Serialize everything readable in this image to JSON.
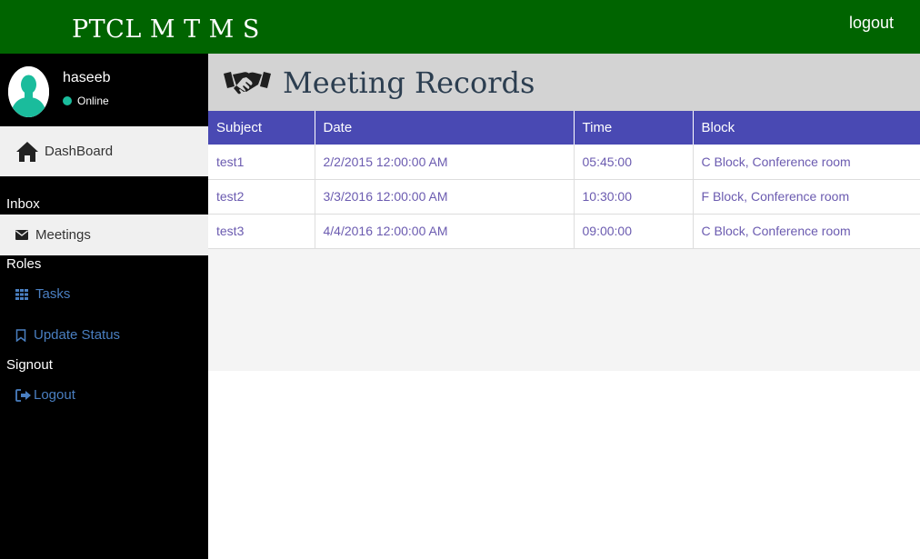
{
  "header": {
    "brand": "PTCL M T M S",
    "logout_label": "logout"
  },
  "user": {
    "name": "haseeb",
    "status": "Online"
  },
  "sidebar": {
    "dashboard_label": "DashBoard",
    "sections": [
      {
        "title": "Inbox"
      },
      {
        "title": "Roles"
      },
      {
        "title": "Signout"
      }
    ],
    "items": {
      "meetings": "Meetings",
      "tasks": "Tasks",
      "update_status": "Update Status",
      "logout": "Logout"
    }
  },
  "page": {
    "title": "Meeting Records"
  },
  "table": {
    "columns": [
      "Subject",
      "Date",
      "Time",
      "Block"
    ],
    "rows": [
      [
        "test1",
        "2/2/2015 12:00:00 AM",
        "05:45:00",
        "C Block, Conference room"
      ],
      [
        "test2",
        "3/3/2016 12:00:00 AM",
        "10:30:00",
        "F Block, Conference room"
      ],
      [
        "test3",
        "4/4/2016 12:00:00 AM",
        "09:00:00",
        "C Block, Conference room"
      ]
    ]
  },
  "colors": {
    "topbar": "#006400",
    "table_header": "#4949b3",
    "status_online": "#1abc9c",
    "link": "#4a7fc1"
  }
}
